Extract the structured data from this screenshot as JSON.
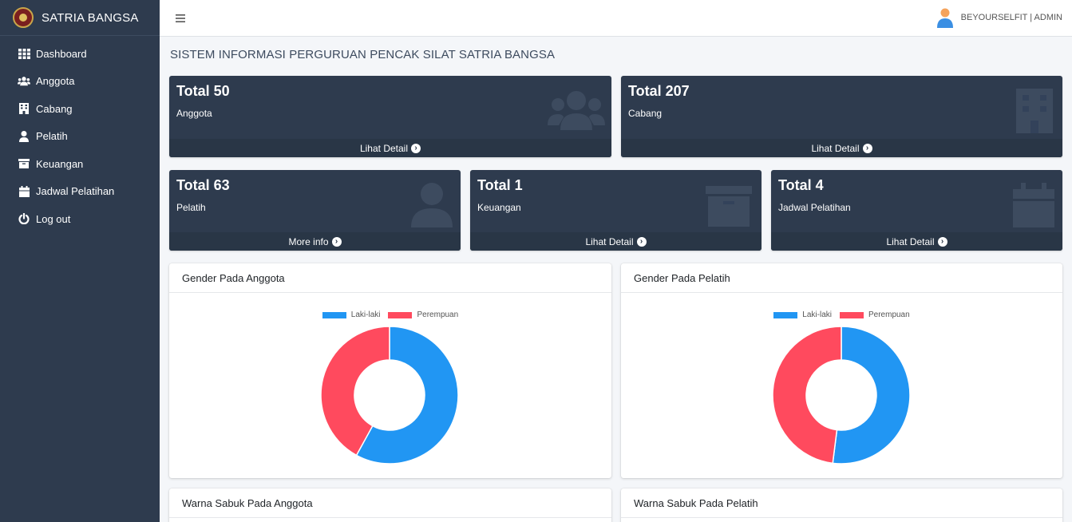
{
  "brand": {
    "name": "SATRIA BANGSA"
  },
  "sidebar": {
    "items": [
      {
        "label": "Dashboard",
        "icon": "dashboard-grid-icon"
      },
      {
        "label": "Anggota",
        "icon": "users-icon"
      },
      {
        "label": "Cabang",
        "icon": "building-icon"
      },
      {
        "label": "Pelatih",
        "icon": "user-icon"
      },
      {
        "label": "Keuangan",
        "icon": "archive-box-icon"
      },
      {
        "label": "Jadwal Pelatihan",
        "icon": "calendar-icon"
      },
      {
        "label": "Log out",
        "icon": "power-icon"
      }
    ]
  },
  "topbar": {
    "menu_icon": "hamburger-icon",
    "user_name": "BEYOURSELFIT | ADMIN"
  },
  "page": {
    "title": "SISTEM INFORMASI PERGURUAN PENCAK SILAT SATRIA BANGSA"
  },
  "stats": [
    {
      "total": "Total 50",
      "label": "Anggota",
      "link": "Lihat Detail",
      "icon": "users-icon"
    },
    {
      "total": "Total 207",
      "label": "Cabang",
      "link": "Lihat Detail",
      "icon": "building-icon"
    },
    {
      "total": "Total 63",
      "label": "Pelatih",
      "link": "More info",
      "icon": "user-icon"
    },
    {
      "total": "Total 1",
      "label": "Keuangan",
      "link": "Lihat Detail",
      "icon": "archive-box-icon"
    },
    {
      "total": "Total 4",
      "label": "Jadwal Pelatihan",
      "link": "Lihat Detail",
      "icon": "calendar-icon"
    }
  ],
  "colors": {
    "sidebar": "#2e3b4e",
    "laki": "#2196f3",
    "perempuan": "#ff4a5e"
  },
  "cards": {
    "gender_anggota": "Gender Pada Anggota",
    "gender_pelatih": "Gender Pada Pelatih",
    "sabuk_anggota": "Warna Sabuk Pada Anggota",
    "sabuk_pelatih": "Warna Sabuk Pada Pelatih"
  },
  "chart_data": [
    {
      "type": "pie",
      "title": "Gender Pada Anggota",
      "categories": [
        "Laki-laki",
        "Perempuan"
      ],
      "values": [
        58,
        42
      ],
      "colors": [
        "#2196f3",
        "#ff4a5e"
      ],
      "legend": "top"
    },
    {
      "type": "pie",
      "title": "Gender Pada Pelatih",
      "categories": [
        "Laki-laki",
        "Perempuan"
      ],
      "values": [
        52,
        48
      ],
      "colors": [
        "#2196f3",
        "#ff4a5e"
      ],
      "legend": "top"
    }
  ]
}
